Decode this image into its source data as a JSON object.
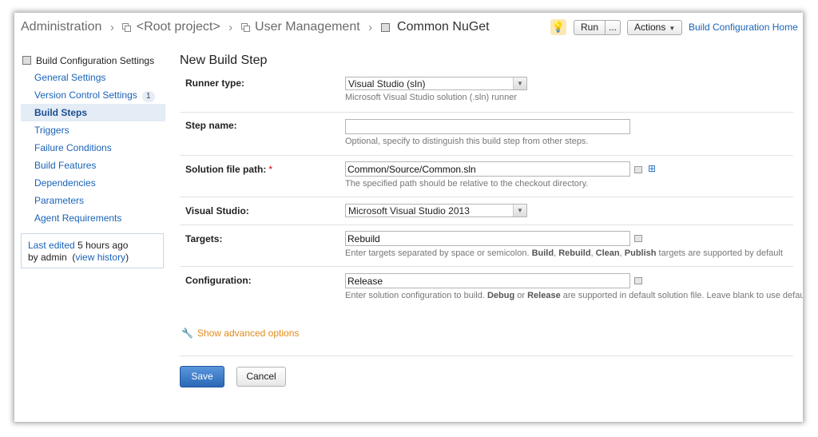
{
  "breadcrumb": {
    "items": [
      "Administration",
      "<Root project>",
      "User Management",
      "Common NuGet"
    ]
  },
  "toolbar": {
    "run_label": "Run",
    "run_more_label": "...",
    "actions_label": "Actions",
    "home_link": "Build Configuration Home"
  },
  "sidebar": {
    "header": "Build Configuration Settings",
    "items": [
      {
        "label": "General Settings"
      },
      {
        "label": "Version Control Settings",
        "badge": "1"
      },
      {
        "label": "Build Steps",
        "active": true
      },
      {
        "label": "Triggers"
      },
      {
        "label": "Failure Conditions"
      },
      {
        "label": "Build Features"
      },
      {
        "label": "Dependencies"
      },
      {
        "label": "Parameters"
      },
      {
        "label": "Agent Requirements"
      }
    ],
    "last_edited": {
      "prefix": "Last edited",
      "time": "5 hours ago",
      "by": "by admin",
      "history_link": "view history"
    }
  },
  "form": {
    "title": "New Build Step",
    "runner_type": {
      "label": "Runner type:",
      "value": "Visual Studio (sln)",
      "hint": "Microsoft Visual Studio solution (.sln) runner"
    },
    "step_name": {
      "label": "Step name:",
      "value": "",
      "hint": "Optional, specify to distinguish this build step from other steps."
    },
    "solution_path": {
      "label": "Solution file path:",
      "required_mark": "*",
      "value": "Common/Source/Common.sln",
      "hint": "The specified path should be relative to the checkout directory."
    },
    "visual_studio": {
      "label": "Visual Studio:",
      "value": "Microsoft Visual Studio 2013"
    },
    "targets": {
      "label": "Targets:",
      "value": "Rebuild",
      "hint_parts": [
        "Enter targets separated by space or semicolon. ",
        "Build",
        ", ",
        "Rebuild",
        ", ",
        "Clean",
        ", ",
        "Publish",
        " targets are supported by default"
      ]
    },
    "configuration": {
      "label": "Configuration:",
      "value": "Release",
      "hint_parts": [
        "Enter solution configuration to build. ",
        "Debug",
        " or ",
        "Release",
        " are supported in default solution file. Leave blank to use default"
      ]
    },
    "advanced_link": "Show advanced options",
    "save_label": "Save",
    "cancel_label": "Cancel"
  },
  "colors": {
    "link": "#1a63b8",
    "accent_orange": "#e08a1c",
    "save_button": "#2a68b6"
  }
}
